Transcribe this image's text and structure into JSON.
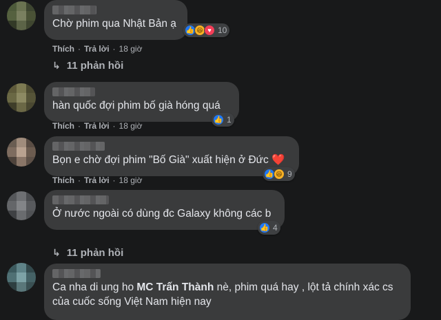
{
  "actions": {
    "like": "Thích",
    "reply": "Trả lời",
    "dot": "·"
  },
  "comments": [
    {
      "text": "Chờ phim qua Nhật Bản ạ",
      "time": "18 giờ",
      "reactions": [
        "like-icon",
        "haha-icon",
        "love-icon"
      ],
      "count": "10",
      "replies": "11 phản hồi"
    },
    {
      "text": "hàn quốc đợi phim bố già hóng quá",
      "time": "18 giờ",
      "reactions": [
        "like-icon"
      ],
      "count": "1"
    },
    {
      "text": "Bọn e chờ đợi phim \"Bố Già\" xuất hiện ở Đức ❤️",
      "time": "18 giờ",
      "reactions": [
        "like-icon",
        "haha-icon"
      ],
      "count": "9"
    },
    {
      "text": "Ở nước ngoài có dùng đc Galaxy không các b",
      "time": "",
      "reactions": [
        "like-icon"
      ],
      "count": "4",
      "replies": "11 phản hồi"
    },
    {
      "text_before": "Ca nha di ung ho ",
      "text_bold": "MC Trấn Thành",
      "text_after": " nè, phim quá hay , lột tả chính xác cs",
      "text_line2": "của cuốc sống Việt Nam hiện nay"
    }
  ]
}
